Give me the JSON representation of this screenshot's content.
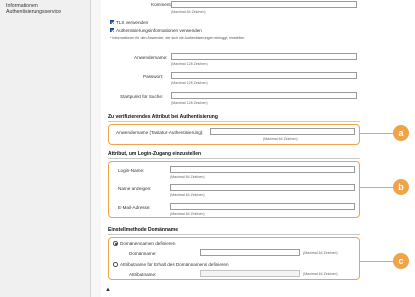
{
  "sidebar": {
    "item": "Informationen Authentisierungsservice"
  },
  "top": {
    "comment_label": "Kommentare:",
    "comment_hint": "(Maximal 64 Zeichen)",
    "tls_label": "TLS verwenden",
    "auth_label": "Authentisierungsinformationen verwenden",
    "auth_note": "* Informationen für den Anwender, der sich nie Authentisierungen einloggt, einstellen.",
    "username_label": "Anwendername:",
    "username_hint": "(Maximal 128 Zeichen)",
    "password_label": "Passwort:",
    "password_hint": "(Maximal 128 Zeichen)",
    "search_label": "Startpunkt für Suche:",
    "search_hint": "(Maximal 128 Zeichen)"
  },
  "verify": {
    "title": "Zu verifizierendes Attribut bei Authentisierung",
    "field_label": "Anwendername (Tastatur-Authentisierung):",
    "field_hint": "(Maximal 64 Zeichen)"
  },
  "login": {
    "title": "Attribut, um Login-Zugang einzustellen",
    "login_label": "Login-Name:",
    "login_hint": "(Maximal 64 Zeichen)",
    "display_label": "Name anzeigen:",
    "display_hint": "(Maximal 64 Zeichen)",
    "email_label": "E-Mail-Adresse:",
    "email_hint": "(Maximal 64 Zeichen)"
  },
  "domain": {
    "title": "Einstellmethode Domänname",
    "opt1": "Domänennamen definieren",
    "domain_label": "Domänname:",
    "domain_hint": "(Maximal 64 Zeichen)",
    "opt2": "Attributname für Erhalt des Domännamens definieren",
    "attr_label": "Attributname:",
    "attr_hint": "(Maximal 64 Zeichen)"
  },
  "callouts": {
    "a": "a",
    "b": "b",
    "c": "c"
  },
  "colors": {
    "accent": "#f0a44a",
    "checkbox": "#1f4e9c"
  },
  "icons": {
    "bottom": "scroll-up-icon"
  }
}
